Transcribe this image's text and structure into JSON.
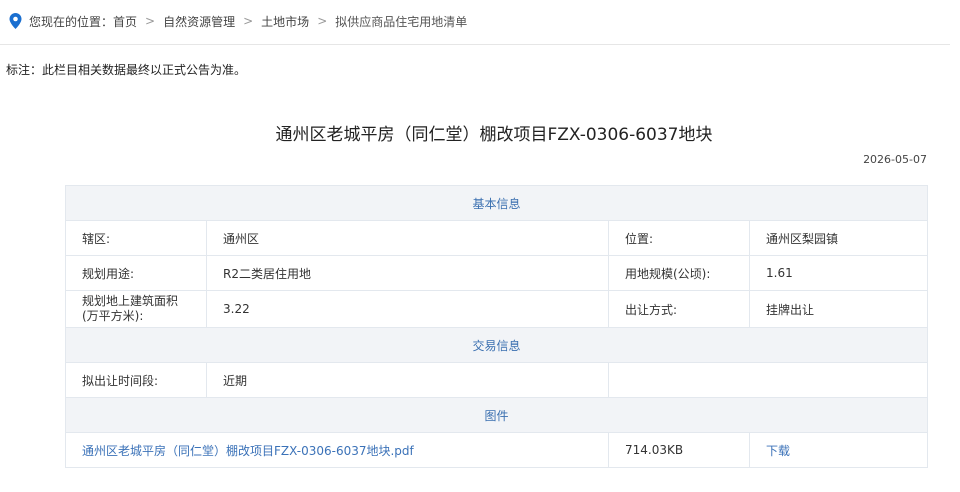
{
  "breadcrumb": {
    "prefix": "您现在的位置：",
    "items": [
      "首页",
      "自然资源管理",
      "土地市场"
    ],
    "separator": ">",
    "current": "拟供应商品住宅用地清单"
  },
  "note": "标注：此栏目相关数据最终以正式公告为准。",
  "title": "通州区老城平房（同仁堂）棚改项目FZX-0306-6037地块",
  "date": "2026-05-07",
  "colors": {
    "accent": "#3a6fb0",
    "pin": "#1a6fd0",
    "section_bg": "#f2f4f7",
    "border": "#e3e8ee"
  },
  "table": {
    "section_basic": "基本信息",
    "row1": {
      "label1": "辖区:",
      "value1": "通州区",
      "label2": "位置:",
      "value2": "通州区梨园镇"
    },
    "row2": {
      "label1": "规划用途:",
      "value1": "R2二类居住用地",
      "label2": "用地规模(公顷):",
      "value2": "1.61"
    },
    "row3": {
      "label1a": "规划地上建筑面积",
      "label1b": "(万平方米):",
      "value1": "3.22",
      "label2": "出让方式:",
      "value2": "挂牌出让"
    },
    "section_trade": "交易信息",
    "row4": {
      "label1": "拟出让时间段:",
      "value1": "近期"
    },
    "section_attach": "图件",
    "attachment": {
      "filename": "通州区老城平房（同仁堂）棚改项目FZX-0306-6037地块.pdf",
      "size": "714.03KB",
      "download": "下载"
    }
  }
}
